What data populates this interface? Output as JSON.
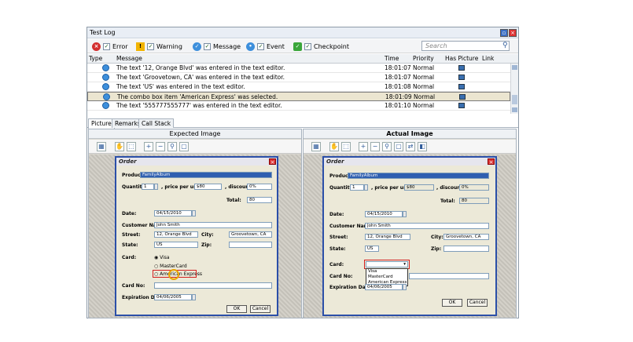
{
  "window": {
    "title": "Test Log"
  },
  "filters": [
    {
      "label": "Error",
      "color": "#d32f2f"
    },
    {
      "label": "Warning",
      "color": "#f2b400"
    },
    {
      "label": "Message",
      "color": "#3d8fdc"
    },
    {
      "label": "Event",
      "color": "#3d8fdc"
    },
    {
      "label": "Checkpoint",
      "color": "#3aa63a"
    }
  ],
  "search": {
    "placeholder": "Search"
  },
  "grid": {
    "columns": [
      "Type",
      "Message",
      "Time",
      "Priority",
      "Has Picture",
      "Link"
    ],
    "rows": [
      {
        "message": "The text '12, Orange Blvd' was entered in the text editor.",
        "time": "18:01:07",
        "priority": "Normal"
      },
      {
        "message": "The text 'Groovetown, CA' was entered in the text editor.",
        "time": "18:01:07",
        "priority": "Normal"
      },
      {
        "message": "The text 'US' was entered in the text editor.",
        "time": "18:01:08",
        "priority": "Normal"
      },
      {
        "message": "The combo box item 'American Express' was selected.",
        "time": "18:01:09",
        "priority": "Normal"
      },
      {
        "message": "The text '555777555777' was entered in the text editor.",
        "time": "18:01:10",
        "priority": "Normal"
      }
    ]
  },
  "tabs": [
    "Picture",
    "Remarks",
    "Call Stack"
  ],
  "expected": {
    "header": "Expected Image",
    "dialog": {
      "title": "Order",
      "product_label": "Product:",
      "product": "FamilyAlbum",
      "quantity_label": "Quantity:",
      "quantity": "1",
      "price_label": ", price per unit:",
      "price": "$80",
      "discount_label": ", discount:",
      "discount": "0%",
      "total_label": "Total:",
      "total": "80",
      "date_label": "Date:",
      "date": "04/15/2010",
      "customer_label": "Customer Name:",
      "customer": "John Smith",
      "street_label": "Street:",
      "street": "12, Orange Blvd",
      "city_label": "City:",
      "city": "Groovetown, CA",
      "state_label": "State:",
      "state": "US",
      "zip_label": "Zip:",
      "card_label": "Card:",
      "card_visa": "Visa",
      "card_mc": "MasterCard",
      "card_amex": "American Express",
      "cardno_label": "Card No:",
      "exp_label": "Expiration Date:",
      "exp": "04/06/2005",
      "ok": "OK",
      "cancel": "Cancel"
    }
  },
  "actual": {
    "header": "Actual Image",
    "dialog": {
      "title": "Order",
      "product_label": "Product:",
      "product": "FamilyAlbum",
      "quantity_label": "Quantity:",
      "quantity": "1",
      "price_label": ", price per unit:",
      "price": "$80",
      "discount_label": ", discount:",
      "discount": "0%",
      "total_label": "Total:",
      "total": "80",
      "date_label": "Date:",
      "date": "04/15/2010",
      "customer_label": "Customer Name:",
      "customer": "John Smith",
      "street_label": "Street:",
      "street": "12, Orange Blvd",
      "city_label": "City:",
      "city": "Groovetown, CA",
      "state_label": "State:",
      "state": "US",
      "zip_label": "Zip:",
      "card_label": "Card:",
      "card_options": [
        "Visa",
        "MasterCard",
        "American Express"
      ],
      "cardno_label": "Card No:",
      "exp_label": "Expiration Date:",
      "exp": "04/06/2005",
      "ok": "OK",
      "cancel": "Cancel"
    }
  }
}
